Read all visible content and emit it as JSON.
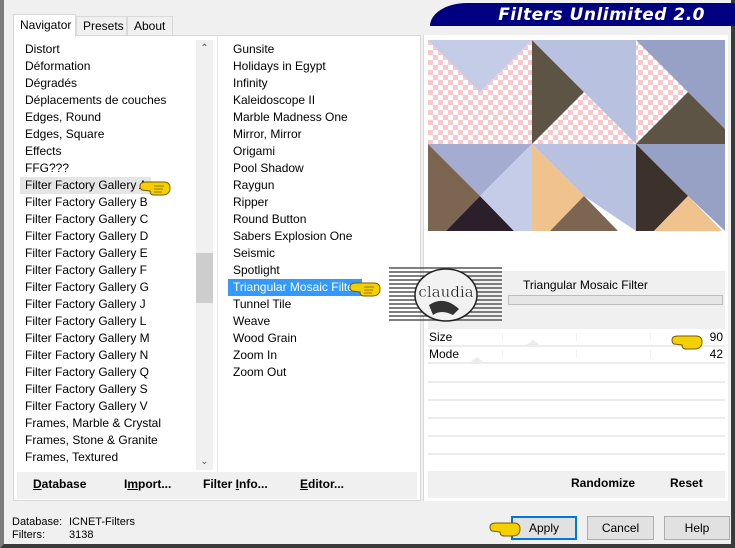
{
  "window": {
    "title": "Filters Unlimited 2.0",
    "banner_color": "#000080"
  },
  "tabs": [
    {
      "label": "Navigator",
      "active": true
    },
    {
      "label": "Presets",
      "active": false
    },
    {
      "label": "About",
      "active": false
    }
  ],
  "categories": {
    "hovered": "Filter Factory Gallery A",
    "items": [
      "Distort",
      "Déformation",
      "Dégradés",
      "Déplacements de couches",
      "Edges, Round",
      "Edges, Square",
      "Effects",
      "FFG???",
      "Filter Factory Gallery A",
      "Filter Factory Gallery B",
      "Filter Factory Gallery C",
      "Filter Factory Gallery D",
      "Filter Factory Gallery E",
      "Filter Factory Gallery F",
      "Filter Factory Gallery G",
      "Filter Factory Gallery J",
      "Filter Factory Gallery L",
      "Filter Factory Gallery M",
      "Filter Factory Gallery N",
      "Filter Factory Gallery Q",
      "Filter Factory Gallery S",
      "Filter Factory Gallery V",
      "Frames, Marble & Crystal",
      "Frames, Stone & Granite",
      "Frames, Textured"
    ]
  },
  "filters": {
    "selected": "Triangular Mosaic Filter",
    "items": [
      "Gunsite",
      "Holidays in Egypt",
      "Infinity",
      "Kaleidoscope II",
      "Marble Madness One",
      "Mirror, Mirror",
      "Origami",
      "Pool Shadow",
      "Raygun",
      "Ripper",
      "Round Button",
      "Sabers Explosion One",
      "Seismic",
      "Spotlight",
      "Triangular Mosaic Filter",
      "Tunnel Tile",
      "Weave",
      "Wood Grain",
      "Zoom In",
      "Zoom Out"
    ]
  },
  "nav_buttons": {
    "database": {
      "pre": "",
      "ul": "D",
      "post": "atabase"
    },
    "import": {
      "pre": "I",
      "ul": "m",
      "post": "port..."
    },
    "filter_info": {
      "pre": "Filter ",
      "ul": "I",
      "post": "nfo..."
    },
    "editor": {
      "pre": "",
      "ul": "E",
      "post": "ditor..."
    }
  },
  "filter_panel": {
    "name": "Triangular Mosaic Filter",
    "params": [
      {
        "label": "Size",
        "value": "90",
        "max": 255
      },
      {
        "label": "Mode",
        "value": "42",
        "max": 255
      }
    ],
    "randomize_label": "Randomize",
    "reset_label": "Reset"
  },
  "status": {
    "database_label": "Database:",
    "database_value": "ICNET-Filters",
    "filters_label": "Filters:",
    "filters_value": "3138"
  },
  "dialog_buttons": {
    "apply": "Apply",
    "cancel": "Cancel",
    "help": "Help"
  },
  "watermark": {
    "text": "claudia"
  },
  "colors": {
    "selection": "#3399ff",
    "preview_light_blue": "#c5cce8",
    "preview_mid_blue": "#b9c1e0",
    "preview_dark_blue": "#97a0c5",
    "preview_olive": "#5e5445",
    "preview_brown": "#7c6652",
    "preview_peach": "#f0c38e",
    "preview_dark": "#2a1f2a",
    "preview_darkbrown": "#3d322b",
    "checker_pink": "#f9c8cc"
  }
}
